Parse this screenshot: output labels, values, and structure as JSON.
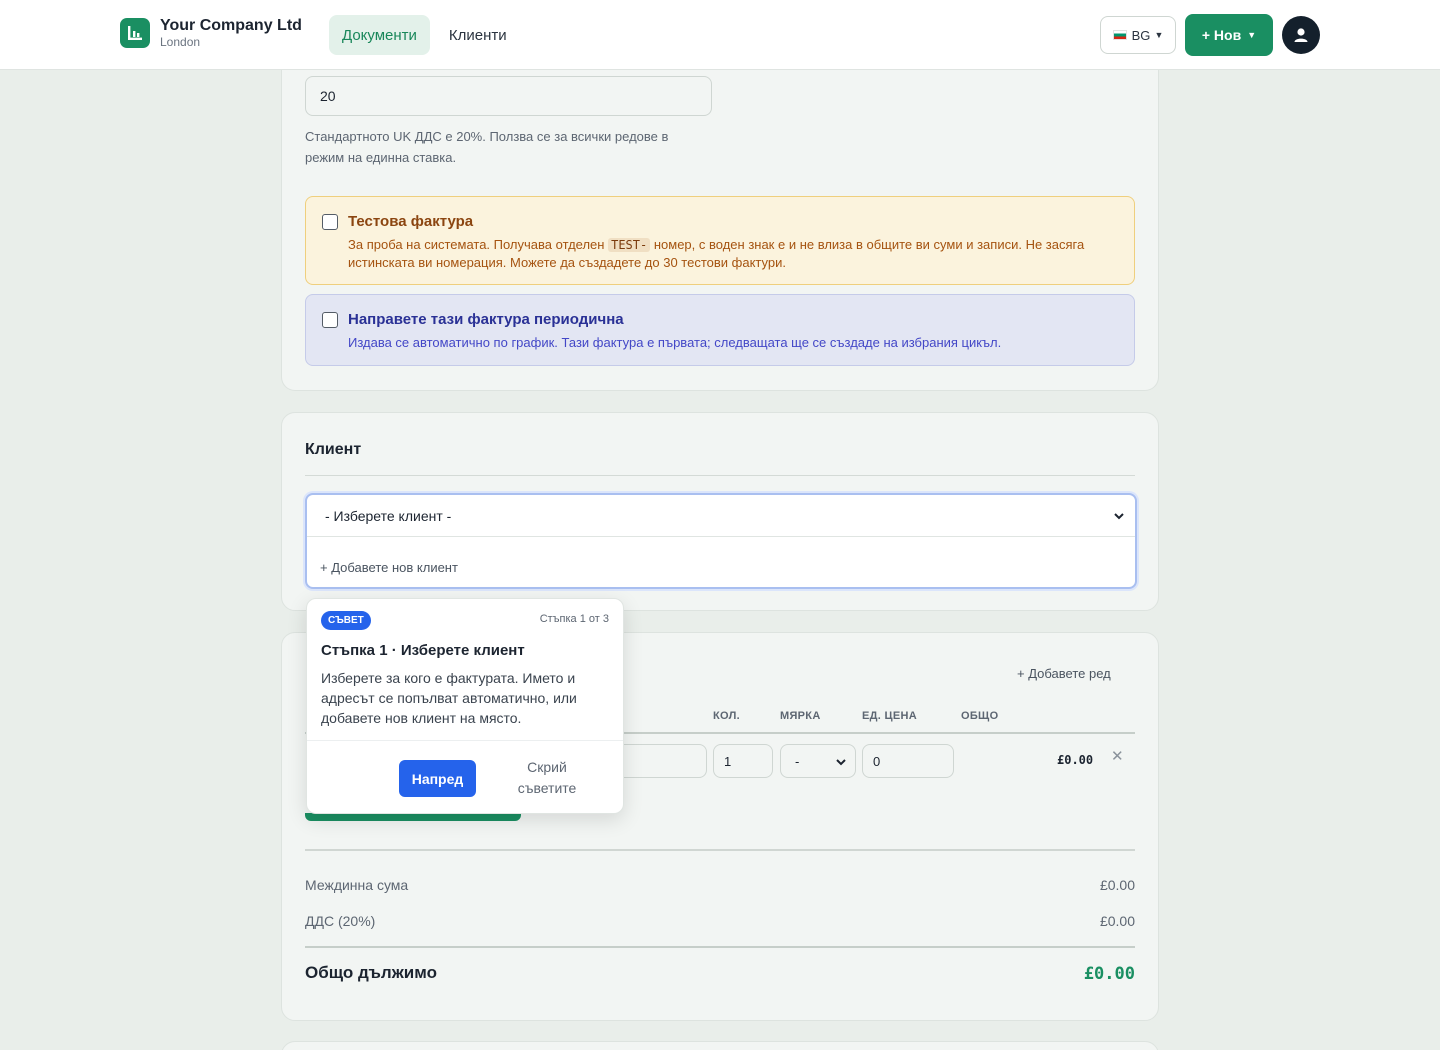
{
  "header": {
    "company_name": "Your Company Ltd",
    "company_city": "London",
    "tabs": [
      {
        "label": "Документи",
        "active": true
      },
      {
        "label": "Клиенти",
        "active": false
      }
    ],
    "language": "BG",
    "new_button": "+ Нов"
  },
  "settings": {
    "vat_rate": "20",
    "vat_help": "Стандартното UK ДДС е 20%. Ползва се за всички редове в режим на единна ставка.",
    "test_invoice": {
      "title": "Тестова фактура",
      "desc_before": "За проба на системата. Получава отделен",
      "code": "TEST-",
      "desc_after": "номер, с воден знак е и не влиза в общите ви суми и записи. Не засяга истинската ви номерация. Можете да създадете до 30 тестови фактури."
    },
    "recurring": {
      "title": "Направете тази фактура периодична",
      "desc": "Издава се автоматично по график. Тази фактура е първата; следващата ще се създаде на избрания цикъл."
    }
  },
  "client": {
    "section_title": "Клиент",
    "select_value": "- Изберете клиент -",
    "add_client": "+ Добавете нов клиент"
  },
  "items": {
    "add_row": "+ Добавете ред",
    "columns": [
      "КОЛ.",
      "МЯРКА",
      "ЕД. ЦЕНА",
      "ОБЩО"
    ],
    "row": {
      "qty": "1",
      "unit": "-",
      "price": "0",
      "total": "£0.00"
    },
    "subtotal_label": "Междинна сума",
    "subtotal_value": "£0.00",
    "vat_label": "ДДС (20%)",
    "vat_value": "£0.00",
    "total_label": "Общо дължимо",
    "total_value": "£0.00"
  },
  "tour": {
    "badge": "СЪВЕТ",
    "step": "Стъпка 1 от 3",
    "title": "Стъпка 1 · Изберете клиент",
    "body": "Изберете за кого е фактурата. Името и адресът се попълват автоматично, или добавете нов клиент на място.",
    "next": "Напред",
    "hide": "Скрий съветите"
  },
  "colors": {
    "accent": "#1a8f62",
    "tour_blue": "#2563eb",
    "warning_bg": "#fbf3dd",
    "info_bg": "#e3e6f3"
  }
}
